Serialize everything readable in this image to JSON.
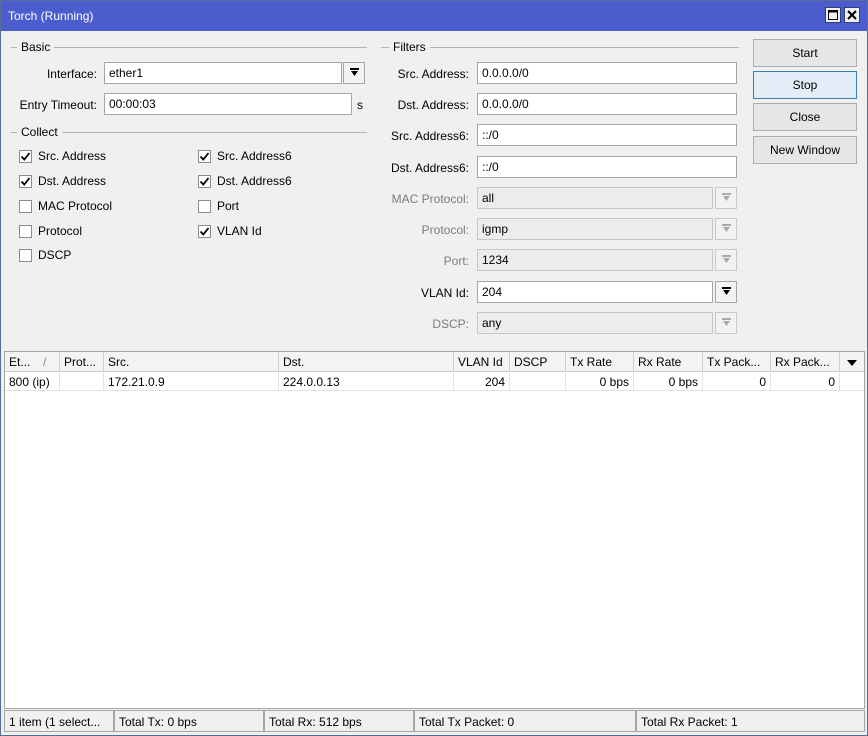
{
  "window": {
    "title": "Torch (Running)",
    "titlebar_color": "#4b5ccd"
  },
  "basic": {
    "legend": "Basic",
    "interface_label": "Interface:",
    "interface_value": "ether1",
    "entry_timeout_label": "Entry Timeout:",
    "entry_timeout_value": "00:00:03",
    "entry_timeout_unit": "s"
  },
  "collect": {
    "legend": "Collect",
    "items": [
      {
        "label": "Src. Address",
        "checked": true
      },
      {
        "label": "Dst. Address",
        "checked": true
      },
      {
        "label": "MAC Protocol",
        "checked": false
      },
      {
        "label": "Protocol",
        "checked": false
      },
      {
        "label": "DSCP",
        "checked": false
      },
      {
        "label": "Src. Address6",
        "checked": true
      },
      {
        "label": "Dst. Address6",
        "checked": true
      },
      {
        "label": "Port",
        "checked": false
      },
      {
        "label": "VLAN Id",
        "checked": true
      }
    ]
  },
  "filters": {
    "legend": "Filters",
    "fields": [
      {
        "label": "Src. Address:",
        "value": "0.0.0.0/0",
        "enabled": true
      },
      {
        "label": "Dst. Address:",
        "value": "0.0.0.0/0",
        "enabled": true
      },
      {
        "label": "Src. Address6:",
        "value": "::/0",
        "enabled": true
      },
      {
        "label": "Dst. Address6:",
        "value": "::/0",
        "enabled": true
      },
      {
        "label": "MAC Protocol:",
        "value": "all",
        "enabled": false
      },
      {
        "label": "Protocol:",
        "value": "igmp",
        "enabled": false
      },
      {
        "label": "Port:",
        "value": "1234",
        "enabled": false
      },
      {
        "label": "VLAN Id:",
        "value": "204",
        "enabled": true
      },
      {
        "label": "DSCP:",
        "value": "any",
        "enabled": false
      }
    ]
  },
  "buttons": {
    "start": "Start",
    "stop": "Stop",
    "close": "Close",
    "new_window": "New Window"
  },
  "table": {
    "columns": [
      "Et...",
      "Prot...",
      "Src.",
      "Dst.",
      "VLAN Id",
      "DSCP",
      "Tx Rate",
      "Rx Rate",
      "Tx Pack...",
      "Rx Pack..."
    ],
    "rows": [
      [
        "800 (ip)",
        "",
        "172.21.0.9",
        "224.0.0.13",
        "204",
        "",
        "0 bps",
        "0 bps",
        "0",
        "0"
      ]
    ]
  },
  "status": {
    "items": "1 item (1 select...",
    "total_tx": "Total Tx: 0 bps",
    "total_rx": "Total Rx: 512 bps",
    "total_tx_packet": "Total Tx Packet: 0",
    "total_rx_packet": "Total Rx Packet: 1"
  }
}
